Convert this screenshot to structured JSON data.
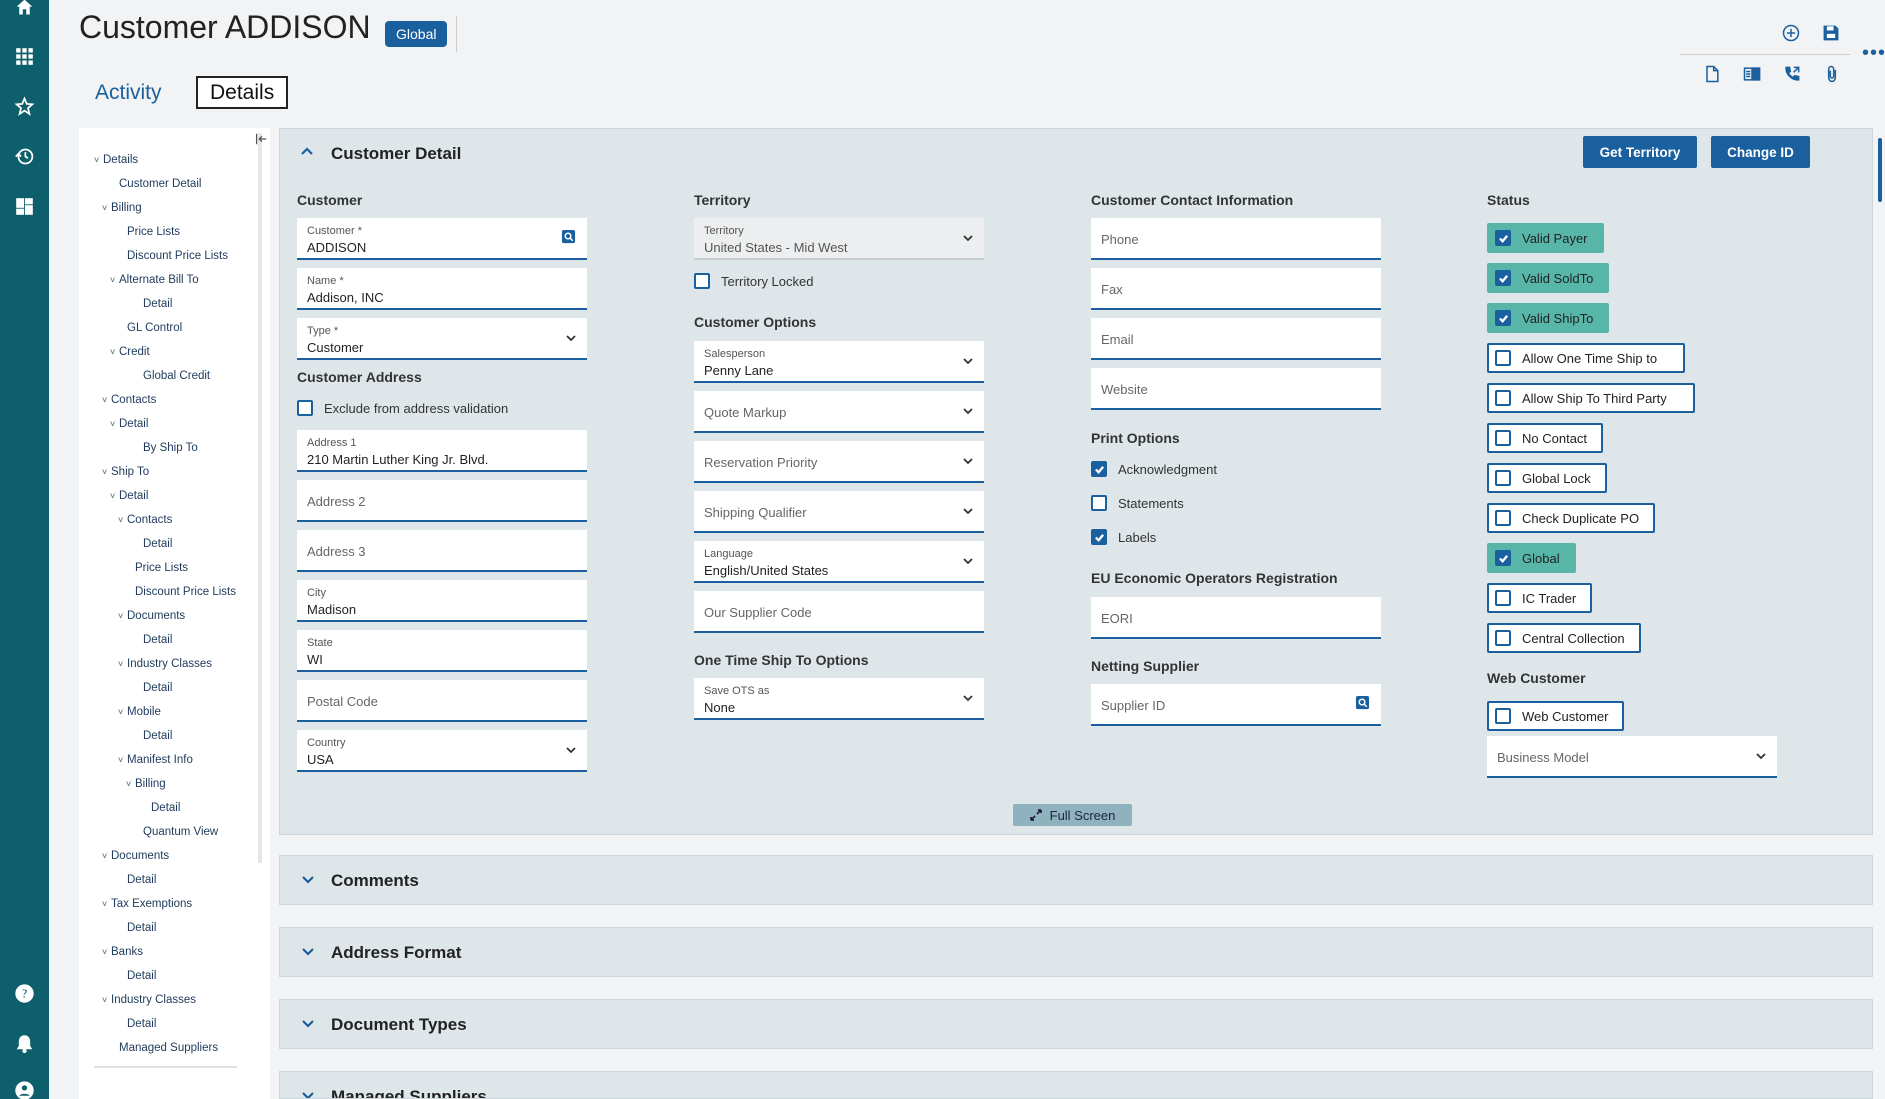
{
  "header": {
    "title": "Customer ADDISON",
    "badge": "Global",
    "tabs": [
      {
        "label": "Activity"
      },
      {
        "label": "Details"
      }
    ]
  },
  "tree": {
    "items": [
      {
        "label": "Details",
        "chev": "˅"
      },
      {
        "label": "Customer Detail",
        "chev": ""
      },
      {
        "label": "Billing",
        "chev": "˅"
      },
      {
        "label": "Price Lists",
        "chev": ""
      },
      {
        "label": "Discount Price Lists",
        "chev": ""
      },
      {
        "label": "Alternate Bill To",
        "chev": "˅"
      },
      {
        "label": "Detail",
        "chev": ""
      },
      {
        "label": "GL Control",
        "chev": ""
      },
      {
        "label": "Credit",
        "chev": "˅"
      },
      {
        "label": "Global Credit",
        "chev": ""
      },
      {
        "label": "Contacts",
        "chev": "˅"
      },
      {
        "label": "Detail",
        "chev": "˅"
      },
      {
        "label": "By Ship To",
        "chev": ""
      },
      {
        "label": "Ship To",
        "chev": "˅"
      },
      {
        "label": "Detail",
        "chev": "˅"
      },
      {
        "label": "Contacts",
        "chev": "˅"
      },
      {
        "label": "Detail",
        "chev": ""
      },
      {
        "label": "Price Lists",
        "chev": ""
      },
      {
        "label": "Discount Price Lists",
        "chev": ""
      },
      {
        "label": "Documents",
        "chev": "˅"
      },
      {
        "label": "Detail",
        "chev": ""
      },
      {
        "label": "Industry Classes",
        "chev": "˅"
      },
      {
        "label": "Detail",
        "chev": ""
      },
      {
        "label": "Mobile",
        "chev": "˅"
      },
      {
        "label": "Detail",
        "chev": ""
      },
      {
        "label": "Manifest Info",
        "chev": "˅"
      },
      {
        "label": "Billing",
        "chev": "˅"
      },
      {
        "label": "Detail",
        "chev": ""
      },
      {
        "label": "Quantum View",
        "chev": ""
      },
      {
        "label": "Documents",
        "chev": "˅"
      },
      {
        "label": "Detail",
        "chev": ""
      },
      {
        "label": "Tax Exemptions",
        "chev": "˅"
      },
      {
        "label": "Detail",
        "chev": ""
      },
      {
        "label": "Banks",
        "chev": "˅"
      },
      {
        "label": "Detail",
        "chev": ""
      },
      {
        "label": "Industry Classes",
        "chev": "˅"
      },
      {
        "label": "Detail",
        "chev": ""
      },
      {
        "label": "Managed Suppliers",
        "chev": ""
      }
    ]
  },
  "panel": {
    "title": "Customer Detail",
    "buttons": {
      "get_territory": "Get Territory",
      "change_id": "Change ID"
    },
    "customer": {
      "heading": "Customer",
      "customer_label": "Customer *",
      "customer_value": "ADDISON",
      "name_label": "Name *",
      "name_value": "Addison, INC",
      "type_label": "Type *",
      "type_value": "Customer"
    },
    "address": {
      "heading": "Customer Address",
      "exclude_label": "Exclude from address validation",
      "address1_label": "Address 1",
      "address1_value": "210 Martin Luther King Jr. Blvd.",
      "address2_placeholder": "Address 2",
      "address3_placeholder": "Address 3",
      "city_label": "City",
      "city_value": "Madison",
      "state_label": "State",
      "state_value": "WI",
      "postal_placeholder": "Postal Code",
      "country_label": "Country",
      "country_value": "USA"
    },
    "territory": {
      "heading": "Territory",
      "territory_label": "Territory",
      "territory_value": "United States - Mid West",
      "locked_label": "Territory Locked"
    },
    "options": {
      "heading": "Customer Options",
      "salesperson_label": "Salesperson",
      "salesperson_value": "Penny Lane",
      "quote_markup_placeholder": "Quote Markup",
      "reservation_placeholder": "Reservation Priority",
      "shipping_placeholder": "Shipping Qualifier",
      "language_label": "Language",
      "language_value": "English/United States",
      "supplier_code_placeholder": "Our Supplier Code"
    },
    "ots": {
      "heading": "One Time Ship To Options",
      "save_label": "Save OTS as",
      "save_value": "None"
    },
    "contact": {
      "heading": "Customer Contact Information",
      "phone_placeholder": "Phone",
      "fax_placeholder": "Fax",
      "email_placeholder": "Email",
      "website_placeholder": "Website"
    },
    "print": {
      "heading": "Print Options",
      "acknowledgment": "Acknowledgment",
      "statements": "Statements",
      "labels": "Labels"
    },
    "eu": {
      "heading": "EU Economic Operators Registration",
      "eori_placeholder": "EORI"
    },
    "netting": {
      "heading": "Netting Supplier",
      "supplier_placeholder": "Supplier ID"
    },
    "status": {
      "heading": "Status",
      "valid_payer": "Valid Payer",
      "valid_soldto": "Valid SoldTo",
      "valid_shipto": "Valid ShipTo",
      "allow_one_time": "Allow One Time Ship to",
      "allow_third_party": "Allow Ship To Third Party",
      "no_contact": "No Contact",
      "global_lock": "Global Lock",
      "check_duplicate": "Check Duplicate PO",
      "global": "Global",
      "ic_trader": "IC Trader",
      "central_collection": "Central Collection"
    },
    "web": {
      "heading": "Web Customer",
      "web_customer": "Web Customer",
      "business_model_placeholder": "Business Model"
    },
    "full_screen": "Full Screen"
  },
  "sections": [
    {
      "title": "Comments"
    },
    {
      "title": "Address Format"
    },
    {
      "title": "Document Types"
    },
    {
      "title": "Managed Suppliers"
    }
  ],
  "colors": {
    "rail": "#0d5f6b",
    "accent": "#1a5f9e",
    "checked_status": "#58b6a9"
  }
}
